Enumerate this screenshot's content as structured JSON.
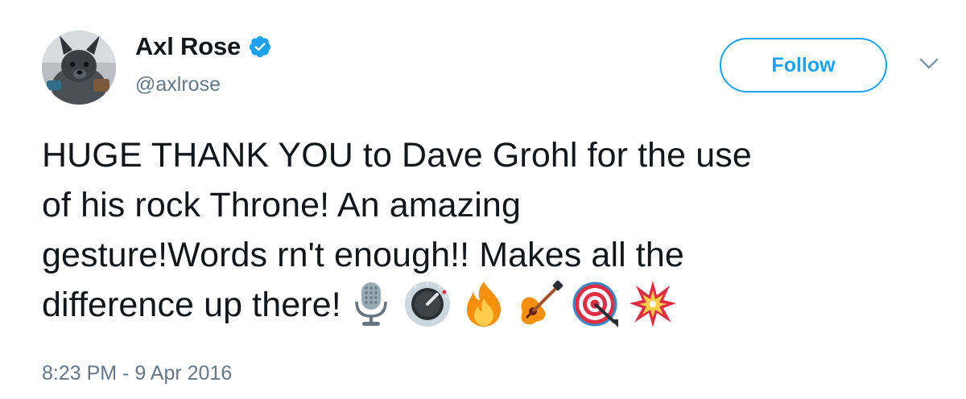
{
  "author": {
    "display_name": "Axl Rose",
    "handle": "@axlrose",
    "verified": true,
    "avatar": "dog-avatar"
  },
  "actions": {
    "follow_label": "Follow",
    "more_icon": "chevron-down-icon"
  },
  "tweet": {
    "lines": [
      "HUGE THANK YOU to Dave Grohl for the use",
      "of his rock Throne! An amazing",
      "gesture!Words rn't enough!! Makes all the",
      "difference up there!"
    ],
    "emojis": [
      "microphone-emoji",
      "control-knob-emoji",
      "fire-emoji",
      "guitar-emoji",
      "direct-hit-emoji",
      "collision-emoji"
    ],
    "timestamp": "8:23 PM - 9 Apr 2016"
  },
  "colors": {
    "accent": "#1da1f2",
    "text": "#14171a",
    "muted": "#657786"
  }
}
